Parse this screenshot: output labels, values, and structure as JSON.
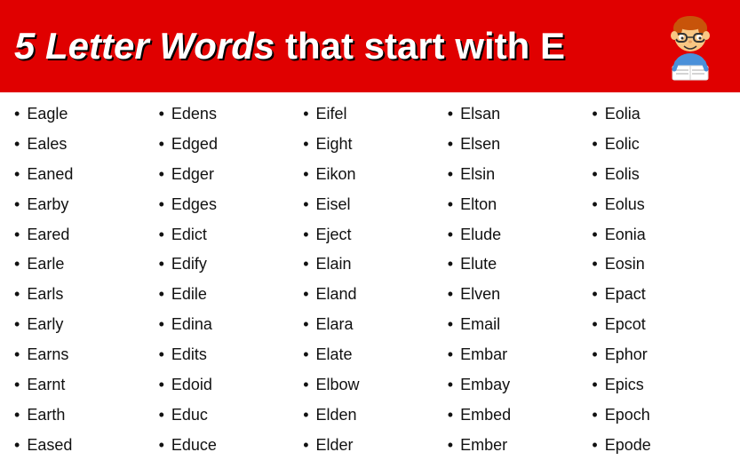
{
  "header": {
    "title_bold": "5 Letter Words",
    "title_regular": " that start with E"
  },
  "columns": [
    {
      "id": "col1",
      "words": [
        "Eagle",
        "Eales",
        "Eaned",
        "Earby",
        "Eared",
        "Earle",
        "Earls",
        "Early",
        "Earns",
        "Earnt",
        "Earth",
        "Eased"
      ]
    },
    {
      "id": "col2",
      "words": [
        "Edens",
        "Edged",
        "Edger",
        "Edges",
        "Edict",
        "Edify",
        "Edile",
        "Edina",
        "Edits",
        "Edoid",
        "Educ",
        "Educe"
      ]
    },
    {
      "id": "col3",
      "words": [
        "Eifel",
        "Eight",
        "Eikon",
        "Eisel",
        "Eject",
        "Elain",
        "Eland",
        "Elara",
        "Elate",
        "Elbow",
        "Elden",
        "Elder"
      ]
    },
    {
      "id": "col4",
      "words": [
        "Elsan",
        "Elsen",
        "Elsin",
        "Elton",
        "Elude",
        "Elute",
        "Elven",
        "Email",
        "Embar",
        "Embay",
        "Embed",
        "Ember"
      ]
    },
    {
      "id": "col5",
      "words": [
        "Eolia",
        "Eolic",
        "Eolis",
        "Eolus",
        "Eonia",
        "Eosin",
        "Epact",
        "Epcot",
        "Ephor",
        "Epics",
        "Epoch",
        "Epode"
      ]
    }
  ],
  "bullet": "•"
}
